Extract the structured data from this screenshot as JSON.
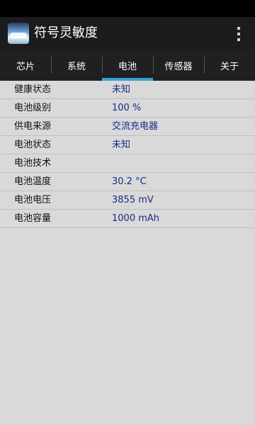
{
  "app": {
    "title": "符号灵敏度",
    "icon": "app-landscape-icon",
    "menu_icon": "overflow-menu-icon"
  },
  "tabs": [
    {
      "label": "芯片",
      "active": false
    },
    {
      "label": "系统",
      "active": false
    },
    {
      "label": "电池",
      "active": true
    },
    {
      "label": "传感器",
      "active": false
    },
    {
      "label": "关于",
      "active": false
    }
  ],
  "battery": [
    {
      "label": "健康状态",
      "value": "未知"
    },
    {
      "label": "电池级别",
      "value": "100 %"
    },
    {
      "label": "供电来源",
      "value": "交流充电器"
    },
    {
      "label": "电池状态",
      "value": "未知"
    },
    {
      "label": "电池技术",
      "value": ""
    },
    {
      "label": "电池温度",
      "value": "30.2 °C"
    },
    {
      "label": "电池电压",
      "value": "3855 mV"
    },
    {
      "label": "电池容量",
      "value": "1000 mAh"
    }
  ],
  "colors": {
    "accent": "#36a3d9",
    "value_text": "#1a2a8a",
    "background": "#d9d9d9"
  }
}
